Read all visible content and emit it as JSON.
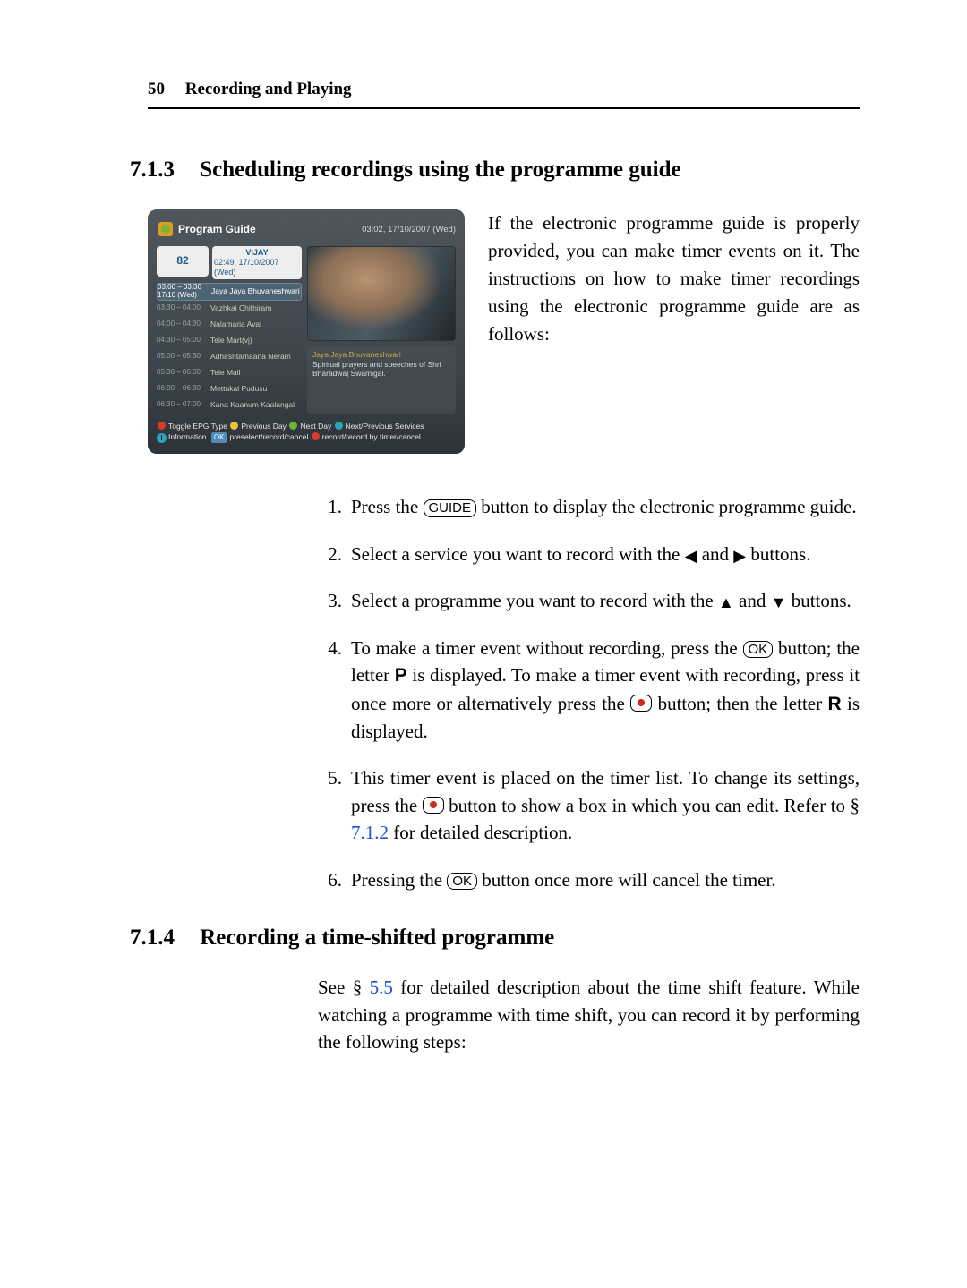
{
  "header": {
    "page_number": "50",
    "chapter_title": "Recording and Playing"
  },
  "section_713": {
    "number": "7.1.3",
    "title": "Scheduling recordings using the programme guide",
    "intro": "If the electronic programme guide is properly provided, you can make timer events on it. The instructions on how to make timer recordings using the electronic programme guide are as follows:"
  },
  "shot": {
    "title": "Program Guide",
    "clock": "03:02, 17/10/2007 (Wed)",
    "channel_number": "82",
    "channel_name": "VIJAY",
    "channel_time": "02:49, 17/10/2007 (Wed)",
    "rows": [
      {
        "time": "03:00 – 03:30\n17/10 (Wed)",
        "prog": "Jaya Jaya Bhuvaneshwari",
        "selected": true
      },
      {
        "time": "03:30 – 04:00",
        "prog": "Vazhkai Chithiram"
      },
      {
        "time": "04:00 – 04:30",
        "prog": "Nalamaria Aval"
      },
      {
        "time": "04:30 – 05:00",
        "prog": "Tele Mart(vj)"
      },
      {
        "time": "05:00 – 05:30",
        "prog": "Adhirshtamaana Neram"
      },
      {
        "time": "05:30 – 06:00",
        "prog": "Tele Mall"
      },
      {
        "time": "06:00 – 06:30",
        "prog": "Mettukal Pudusu"
      },
      {
        "time": "06:30 – 07:00",
        "prog": "Kana Kaanum Kaalangal"
      }
    ],
    "info_title": "Jaya Jaya Bhuvaneshwari",
    "info_desc": "Spiritual prayers and speeches of Shri Bharadwaj Swamigal.",
    "hint1_a": "Toggle EPG Type",
    "hint1_b": "Previous Day",
    "hint1_c": "Next Day",
    "hint1_d": "Next/Previous Services",
    "hint2_a": "Information",
    "hint2_ok": "OK",
    "hint2_b": "preselect/record/cancel",
    "hint2_c": "record/record by timer/cancel"
  },
  "steps": {
    "s1_a": "Press the ",
    "s1_key": "GUIDE",
    "s1_b": " button to display the electronic programme guide.",
    "s2_a": "Select a service you want to record with the ",
    "s2_b": " and ",
    "s2_c": " buttons.",
    "s3_a": "Select a programme you want to record with the ",
    "s3_b": " and ",
    "s3_c": " buttons.",
    "s4_a": "To make a timer event without recording, press the ",
    "s4_ok": "OK",
    "s4_b": " button; the letter ",
    "s4_P": "P",
    "s4_c": " is displayed. To make a timer event with recording, press it once more or alternatively press the ",
    "s4_d": " button; then the letter ",
    "s4_R": "R",
    "s4_e": " is displayed.",
    "s5_a": "This timer event is placed on the timer list. To change its settings, press the ",
    "s5_b": " button to show a box in which you can edit. Refer to § ",
    "s5_link": "7.1.2",
    "s5_c": " for detailed description.",
    "s6_a": "Pressing the ",
    "s6_ok": "OK",
    "s6_b": " button once more will cancel the timer."
  },
  "section_714": {
    "number": "7.1.4",
    "title": "Recording a time-shifted programme",
    "para_a": "See § ",
    "para_link": "5.5",
    "para_b": " for detailed description about the time shift feature. While watching a programme with time shift, you can record it by performing the following steps:"
  }
}
